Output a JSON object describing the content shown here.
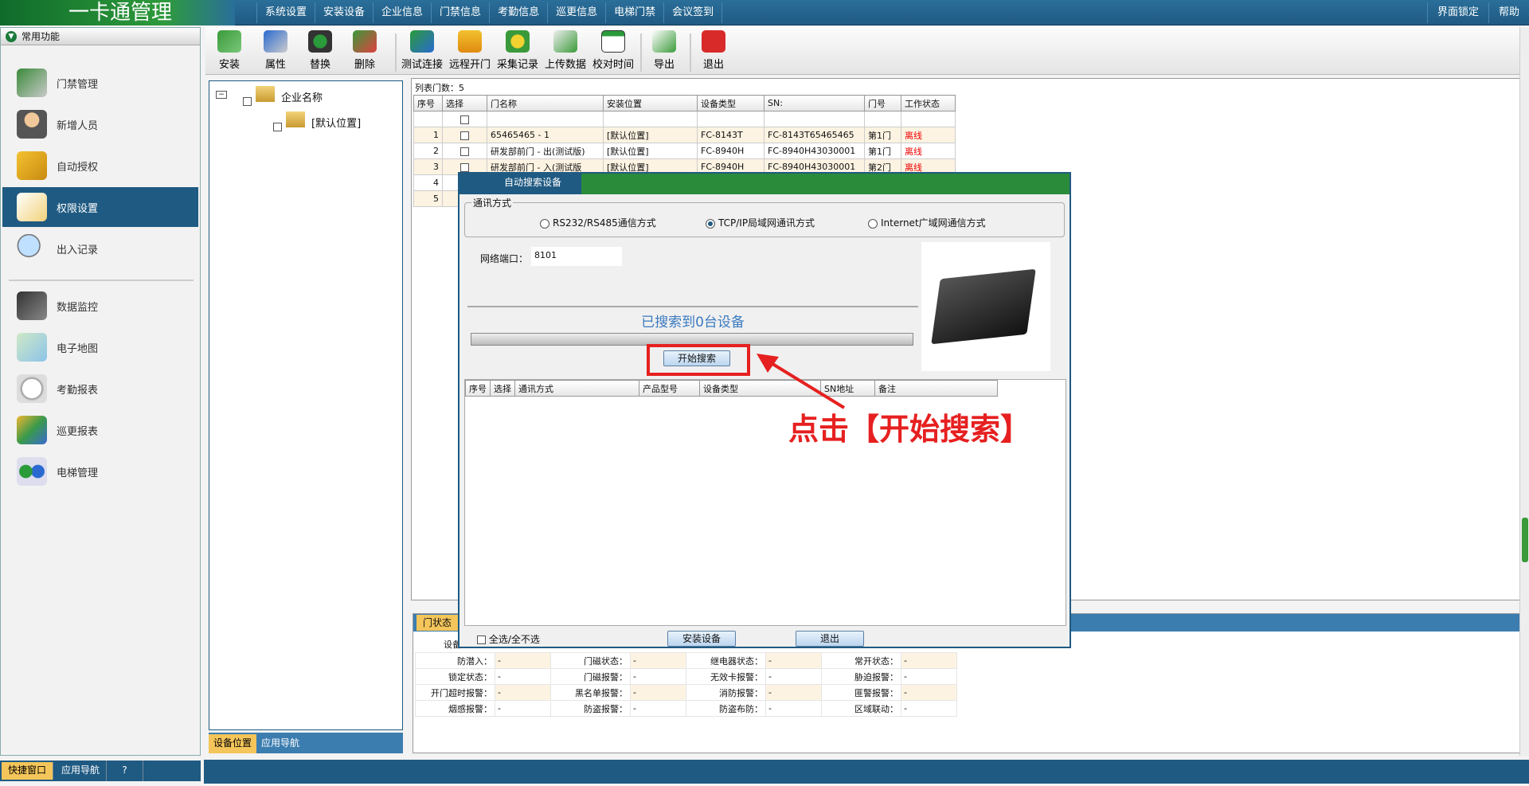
{
  "app": {
    "title": "一卡通管理"
  },
  "menu": [
    "系统设置",
    "安装设备",
    "企业信息",
    "门禁信息",
    "考勤信息",
    "巡更信息",
    "电梯门禁",
    "会议签到"
  ],
  "right_menu": [
    "界面锁定",
    "帮助"
  ],
  "sidebar": {
    "header": "常用功能",
    "group1": [
      "门禁管理",
      "新增人员",
      "自动授权",
      "权限设置",
      "出入记录"
    ],
    "group2": [
      "数据监控",
      "电子地图",
      "考勤报表",
      "巡更报表",
      "电梯管理"
    ],
    "bottom_tabs": [
      "快捷窗口",
      "应用导航"
    ]
  },
  "toolbar": [
    "安装",
    "属性",
    "替换",
    "删除",
    "测试连接",
    "远程开门",
    "采集记录",
    "上传数据",
    "校对时间",
    "导出",
    "退出"
  ],
  "tree": {
    "root": "企业名称",
    "child": "[默认位置]",
    "tabs": [
      "设备位置",
      "应用导航"
    ]
  },
  "list": {
    "count_label": "列表门数：5",
    "headers": [
      "序号",
      "选择",
      "门名称",
      "安装位置",
      "设备类型",
      "SN:",
      "门号",
      "工作状态"
    ],
    "rows": [
      {
        "no": "1",
        "name": "65465465 - 1",
        "loc": "[默认位置]",
        "type": "FC-8143T",
        "sn": "FC-8143T65465465",
        "door": "第1门",
        "status": "离线"
      },
      {
        "no": "2",
        "name": "研发部前门 - 出(测试版)",
        "loc": "[默认位置]",
        "type": "FC-8940H",
        "sn": "FC-8940H43030001",
        "door": "第1门",
        "status": "离线"
      },
      {
        "no": "3",
        "name": "研发部前门 - 入(测试版",
        "loc": "[默认位置]",
        "type": "FC-8940H",
        "sn": "FC-8940H43030001",
        "door": "第2门",
        "status": "离线"
      },
      {
        "no": "4"
      },
      {
        "no": "5"
      }
    ]
  },
  "door_status": {
    "tab": "门状态",
    "label_device": "设备",
    "rows": [
      [
        [
          "防潜入：",
          "-"
        ],
        [
          "门磁状态：",
          "-"
        ],
        [
          "继电器状态：",
          "-"
        ],
        [
          "常开状态：",
          "-"
        ]
      ],
      [
        [
          "锁定状态：",
          "-"
        ],
        [
          "门磁报警：",
          "-"
        ],
        [
          "无效卡报警：",
          "-"
        ],
        [
          "胁迫报警：",
          "-"
        ]
      ],
      [
        [
          "开门超时报警：",
          "-"
        ],
        [
          "黑名单报警：",
          "-"
        ],
        [
          "消防报警：",
          "-"
        ],
        [
          "匪警报警：",
          "-"
        ]
      ],
      [
        [
          "烟感报警：",
          "-"
        ],
        [
          "防盗报警：",
          "-"
        ],
        [
          "防盗布防：",
          "-"
        ],
        [
          "区域联动：",
          "-"
        ]
      ]
    ]
  },
  "dialog": {
    "title": "自动搜索设备",
    "comm_label": "通讯方式",
    "options": [
      "RS232/RS485通信方式",
      "TCP/IP局域网通讯方式",
      "Internet广域网通信方式"
    ],
    "selected": "TCP/IP局域网通讯方式",
    "port_label": "网络端口：",
    "port_value": "8101",
    "found_text": "已搜索到0台设备",
    "search_button": "开始搜索",
    "result_headers": [
      "序号",
      "选择",
      "通讯方式",
      "产品型号",
      "设备类型",
      "SN地址",
      "备注"
    ],
    "select_all": "全选/全不选",
    "install_button": "安装设备",
    "exit_button": "退出"
  },
  "annotation": {
    "text": "点击【开始搜索】",
    "color": "#e62020"
  }
}
